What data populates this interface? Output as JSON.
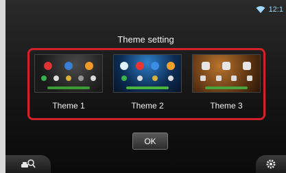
{
  "status_bar": {
    "time": "12:1",
    "wifi_icon": "wifi-icon"
  },
  "dialog": {
    "title": "Theme setting"
  },
  "themes": [
    {
      "label": "Theme 1"
    },
    {
      "label": "Theme 2"
    },
    {
      "label": "Theme 3"
    }
  ],
  "buttons": {
    "ok_label": "OK"
  },
  "bottom_bar": {
    "left_icon": "search-car-icon",
    "right_icon": "gear-icon"
  },
  "colors": {
    "selection_frame": "#d4202a",
    "status_text": "#9fd9ff"
  }
}
